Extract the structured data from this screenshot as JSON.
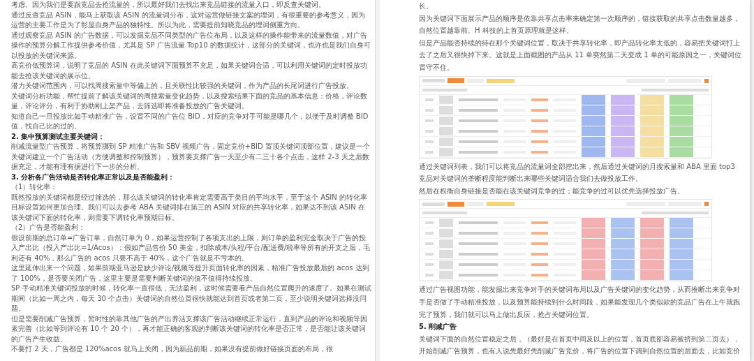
{
  "left_page": {
    "blocks": [
      {
        "kind": "paragraph",
        "text": "考虑。因为我们是要跟竞品去抢流量的，所以最好我们去找出来竞品链接的流量入口，即反查关键词。"
      },
      {
        "kind": "paragraph",
        "text": "通过反查竞品 ASIN，能马上获取该 ASIN 的流量词分布，这对运营做链接文案的埋词，有很重要的参考意义，因为运营的主要工作是为了彰显自身产品的独特性。所以为此，需要提前知晓竞品的埋词侧重方向。"
      },
      {
        "kind": "paragraph",
        "text": "通过观察竞品 ASIN 的广告数据，可以发掘竞品不同类型的广告位布局，以及这样的操作能带来的流量数值，对广告操作的预算分解工作提供参考价值，尤其是 SP 广告流量 Top10 的数据统计，这部分的关键词，也许也是我们自身可以投放的关键词来源。"
      },
      {
        "kind": "paragraph",
        "text": "高竞价低预算词，说明了竞品的 ASIN 在此关键词下面预算不充足，如果关键词合适，可以利用关键词的定时投放功能去抢该关键词的展示位。"
      },
      {
        "kind": "paragraph",
        "text": "潜力关键词范围内，可以找周搜索量中等偏上的，且关联性比较强的关键词，作为产品的长尾词进行广告投放。"
      },
      {
        "kind": "paragraph",
        "text": "关键词分析功能，帮忙提前了解该关键词的周搜索量变化趋势，以及搜索结果下面的竞品的基本信息：价格，评论数量，评论评分，有利于协助刚上架产品，去筛选即将准备投放的广告关键词。"
      },
      {
        "kind": "paragraph",
        "text": "知道自己一旦投放比如手动精准广告，设置不同的广告位 BID，对应的竞争对手可能是哪几个，以便于及时调整 BID 值，找自己比的过的。"
      },
      {
        "kind": "heading",
        "text": "2. 集中预算测试主要关键词："
      },
      {
        "kind": "paragraph",
        "text": "削减流量型广告预算，将预算挪到 SP 精准广告和 SBV 视频广告，固定竞价+BID 置顶关键词顶部位置，建议是一个关键词建立一个广告活动（方便调整和控制预算），预算要支撑广告一天至少有二三十各个点击，这样 2-3 天之后数据充足，才能有理有据进行下一步的分析。"
      },
      {
        "kind": "heading",
        "text": "3. 分析各广告活动是否转化率正常以及是否能盈利："
      },
      {
        "kind": "paragraph",
        "text": "（1）转化率："
      },
      {
        "kind": "paragraph",
        "text": "既然投放的关键词都是经过筛选的，那么该关键词的转化率肯定需要高于类目的平均水平，至于这个 ASIN 的转化率目标设置如何更加合理。我们可以去参考 ABA 关键词排在第三的 ASIN 对应的共享转化率，如果达不到该 ASIN 在该关键词下面的转化率，则需要下调转化率预期目标。"
      },
      {
        "kind": "paragraph",
        "text": "（2）广告是否能盈利："
      },
      {
        "kind": "paragraph",
        "text": "假设前期的总订单=广告订单，自然订单为 0，如果运营控制了各项支出的上限，则订单的盈利完全取决于广告的投入产出比（投入产出比=1/Acos）；假如产品售价 50 美金，扣除成本/头程/平台/配送费/税率等所有的开支之后，毛利还有 40%，那么广告的 acos 只要不高于 40%，这个广告就是不亏本的。"
      },
      {
        "kind": "paragraph",
        "text": "这里延伸出来一个问题，如果前期亚马逊是缺少评论/视频等提升页面转化率的因素，精准广告投放最后的 acos 达到了 100%，是否要关闭广告，这里主要是需要判断关键词的值不值得持续投放。"
      },
      {
        "kind": "paragraph",
        "text": "SP 手动精准关键词投放的时候，转化率一直很低，无法盈利，这时候需要看产品自然位置爬升的速度了。如果在测试期间（比如一周之内，每天 30 个点击）关键词的自然位置很快就能达到首页或者第二页，至少说明关键词选择没问题。"
      },
      {
        "kind": "paragraph",
        "text": "但是需要削减广告预算，暂时性的靠其他广告的产出养活支撑该广告活动继续正常运行，直到产品的评论和视频等因素完善（比如等到评论有 10 个 20 个），再才能正确的客观的判断该关键词的转化率是否正常，是否能让该关键词的广告产生收益。"
      },
      {
        "kind": "paragraph",
        "text": "不要打 2 天，广告都是 120%acos 就马上关闭，因为新品前期，如果没有提前做好链接页面的布局，很"
      }
    ]
  },
  "right_page": {
    "blocks": [
      {
        "kind": "paragraph",
        "text": "长。"
      },
      {
        "kind": "paragraph",
        "text": "因为关键词下面展示产品的顺序是依靠共享点击率来确定第一次顺序的，链接获取的共享点击数量越多，自然位置越靠前。H 科技的上首页原理就是这样。"
      },
      {
        "kind": "paragraph",
        "text": "但是产品能否持续的待在那个关键词位置，取决于共享转化率，即产品转化率太低的，容易把关键词打上去了之后又很快掉下来。这就是上面截图的产品从 11 单突然第二天变成 1 单的可能原因之一，关键词位置守不住。"
      },
      {
        "kind": "image"
      },
      {
        "kind": "paragraph",
        "text": "通过关键词列表，我们可以将竞品的流量词全部挖出来，然后通过关键词的月搜索量和 ABA 里面 top3 竞品对关键词的垄断程度能判断出来哪些关键词适合我们去做投放工作。"
      },
      {
        "kind": "paragraph",
        "text": "然后在权衡自身链接是否能在该关键词竞争的过；能竞争的过可以优先选择投放广告。"
      },
      {
        "kind": "image"
      },
      {
        "kind": "paragraph",
        "text": "通过广告视图功能，能发掘出来竞争对手的关键词布局以及广告关键词的变化趋势，从而推断出来竞争对手是否做了手动精准投放，以及预算能持续到什么时间段，如果能发现几个类似款的竞品广告在上午就跑完了预算，我们就可以马上做出反应，抢占关键词位置。"
      },
      {
        "kind": "heading",
        "text": "5. 削减广告"
      },
      {
        "kind": "paragraph",
        "text": "关键词下面的自然位置稳定之后，（最好是在首页中间及以上的位置，首页底部容易被挤到第二页去），开始削减广告预算，也有人说先最好先削减广告竞价，将广告的位置下调到自然位置的后面去，比如竞价"
      }
    ]
  }
}
